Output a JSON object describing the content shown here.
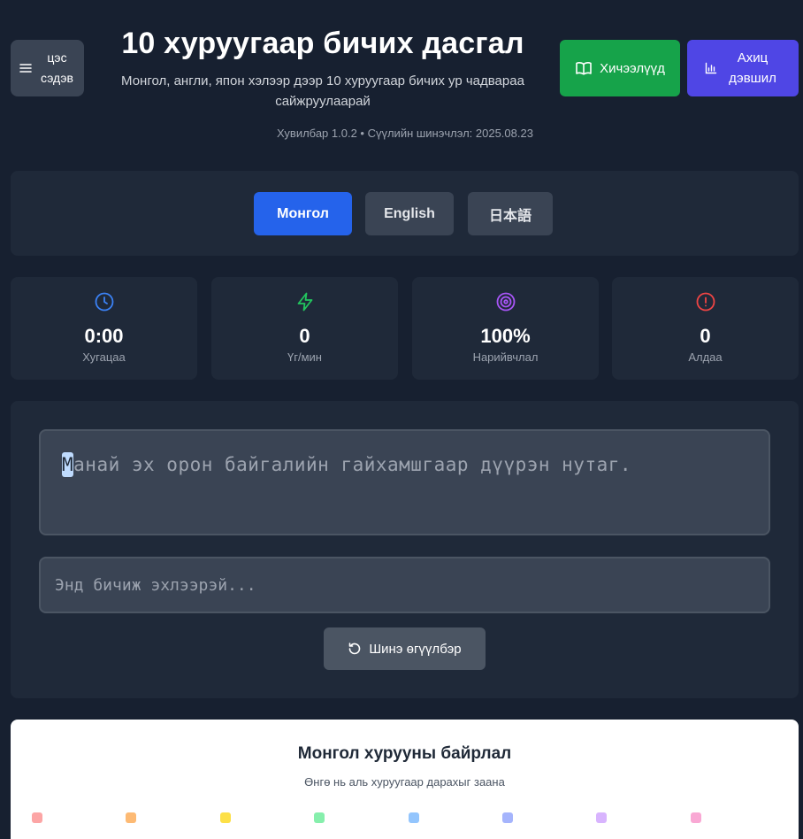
{
  "header": {
    "menu_label": "цэс сэдэв",
    "title": "10 хуруугаар бичих дасгал",
    "subtitle": "Монгол, англи, япон хэлээр дээр 10 хуруугаар бичих ур чадвараа сайжруулаарай",
    "version": "Хувилбар 1.0.2 • Сүүлийн шинэчлэл: 2025.08.23",
    "lessons_label": "Хичээлүүд",
    "progress_label": "Ахиц дэвшил"
  },
  "languages": [
    {
      "label": "Монгол",
      "active": true
    },
    {
      "label": "English",
      "active": false
    },
    {
      "label": "日本語",
      "active": false
    }
  ],
  "stats": [
    {
      "value": "0:00",
      "label": "Хугацаа",
      "icon": "clock-icon",
      "color": "#3b82f6"
    },
    {
      "value": "0",
      "label": "Үг/мин",
      "icon": "lightning-icon",
      "color": "#22c55e"
    },
    {
      "value": "100%",
      "label": "Нарийвчлал",
      "icon": "target-icon",
      "color": "#a855f7"
    },
    {
      "value": "0",
      "label": "Алдаа",
      "icon": "alert-icon",
      "color": "#ef4444"
    }
  ],
  "typing": {
    "current_char": "М",
    "remaining_text": "анай эх орон байгалийн гайхамшгаар дүүрэн нутаг.",
    "input_placeholder": "Энд бичиж эхлээрэй...",
    "input_value": "",
    "new_sentence_label": "Шинэ өгүүлбэр"
  },
  "keyboard": {
    "title": "Монгол хурууны байрлал",
    "subtitle": "Өнгө нь аль хуруугаар дарахыг заана",
    "finger_colors": [
      "#fca5a5",
      "#fdba74",
      "#fde047",
      "#86efac",
      "#93c5fd",
      "#a5b4fc",
      "#d8b4fe",
      "#f9a8d4"
    ]
  },
  "colors": {
    "background": "#172030",
    "panel": "#1f2939",
    "primary": "#2563eb",
    "success": "#16a34a",
    "indigo": "#4f46e5"
  }
}
